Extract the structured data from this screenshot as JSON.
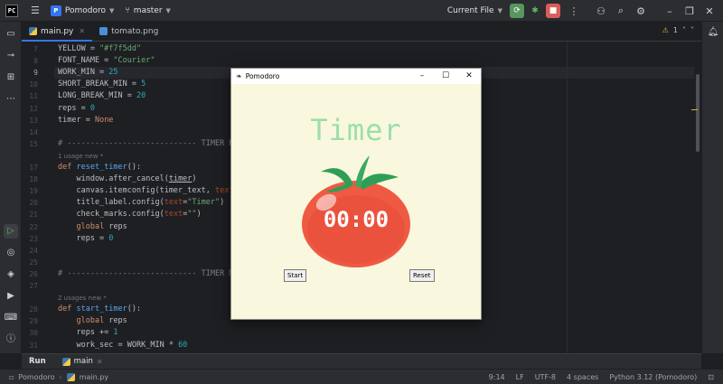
{
  "titlebar": {
    "logo": "PC",
    "project_badge": "P",
    "project_name": "Pomodoro",
    "branch": "master",
    "run_config": "Current File",
    "icons": [
      "menu-icon",
      "branch-icon",
      "debug-running-icon",
      "debug-icon",
      "stop-icon",
      "more-icon",
      "add-user-icon",
      "search-icon",
      "settings-icon",
      "minimize-icon",
      "restore-icon",
      "close-icon"
    ]
  },
  "tabs": [
    {
      "label": "main.py"
    },
    {
      "label": "tomato.png"
    }
  ],
  "inspections": {
    "warning_count": "1"
  },
  "code_lines": [
    {
      "num": "7",
      "html": "YELLOW = <span class=\"s\">\"#f7f5dd\"</span>"
    },
    {
      "num": "8",
      "html": "FONT_NAME = <span class=\"s\">\"Courier\"</span>"
    },
    {
      "num": "9",
      "html": "WORK_MIN = <span class=\"n\">25</span>",
      "current": true
    },
    {
      "num": "10",
      "html": "SHORT_BREAK_MIN = <span class=\"n\">5</span>"
    },
    {
      "num": "11",
      "html": "LONG_BREAK_MIN = <span class=\"n\">20</span>"
    },
    {
      "num": "12",
      "html": "reps = <span class=\"n\">0</span>"
    },
    {
      "num": "13",
      "html": "timer = <span class=\"k\">None</span>"
    },
    {
      "num": "14",
      "html": ""
    },
    {
      "num": "15",
      "html": "<span class=\"cm\"># ---------------------------- TIMER RESE</span>"
    },
    {
      "hint": "1 usage   new *"
    },
    {
      "num": "17",
      "html": "<span class=\"k\">def</span> <span class=\"f\">reset_timer</span>():"
    },
    {
      "num": "18",
      "html": "    window.after_cancel(<span style=\"text-decoration:underline\">timer</span>)"
    },
    {
      "num": "19",
      "html": "    canvas.itemconfig(timer_text, <span class=\"p\">text</span>=<span class=\"s\">\"0</span>"
    },
    {
      "num": "20",
      "html": "    title_label.config(<span class=\"p\">text</span>=<span class=\"s\">\"Timer\"</span>)"
    },
    {
      "num": "21",
      "html": "    check_marks.config(<span class=\"p\">text</span>=<span class=\"s\">\"\"</span>)"
    },
    {
      "num": "22",
      "html": "    <span class=\"k\">global</span> reps"
    },
    {
      "num": "23",
      "html": "    reps = <span class=\"n\">0</span>"
    },
    {
      "num": "24",
      "html": ""
    },
    {
      "num": "25",
      "html": ""
    },
    {
      "num": "26",
      "html": "<span class=\"cm\"># ---------------------------- TIMER MECH</span>"
    },
    {
      "num": "27",
      "html": ""
    },
    {
      "hint": "2 usages   new *"
    },
    {
      "num": "28",
      "html": "<span class=\"k\">def</span> <span class=\"f\">start_timer</span>():"
    },
    {
      "num": "29",
      "html": "    <span class=\"k\">global</span> reps"
    },
    {
      "num": "30",
      "html": "    reps += <span class=\"n\">1</span>"
    },
    {
      "num": "31",
      "html": "    work_sec = WORK_MIN * <span class=\"n\">60</span>"
    }
  ],
  "tk_window": {
    "title": "Pomodoro",
    "heading": "Timer",
    "timer_text": "00:00",
    "start_label": "Start",
    "reset_label": "Reset",
    "bg_color": "#f9f7dd",
    "heading_color": "#9bdeac"
  },
  "run_panel": {
    "label": "Run",
    "config": "main"
  },
  "statusbar": {
    "project": "Pomodoro",
    "file": "main.py",
    "position": "9:14",
    "line_sep": "LF",
    "encoding": "UTF-8",
    "indent": "4 spaces",
    "interpreter": "Python 3.12 (Pomodoro)"
  }
}
